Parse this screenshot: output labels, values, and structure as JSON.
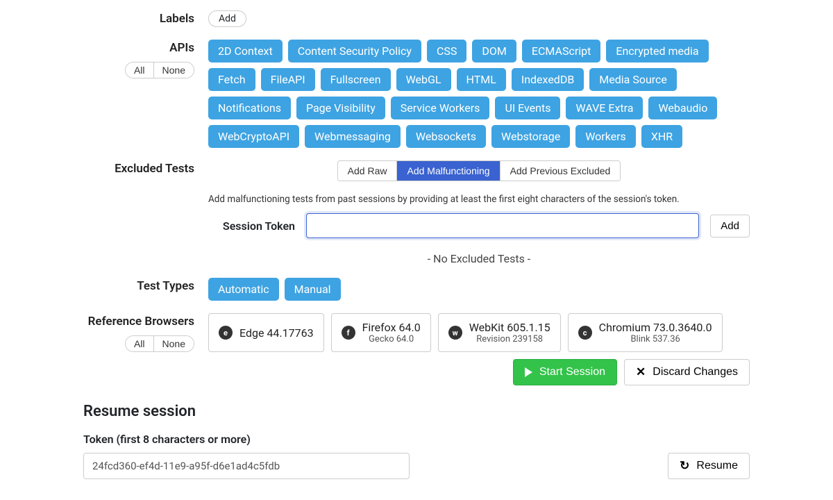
{
  "labels": {
    "title": "Labels",
    "add": "Add"
  },
  "apis": {
    "title": "APIs",
    "all": "All",
    "none": "None",
    "items": [
      "2D Context",
      "Content Security Policy",
      "CSS",
      "DOM",
      "ECMAScript",
      "Encrypted media",
      "Fetch",
      "FileAPI",
      "Fullscreen",
      "WebGL",
      "HTML",
      "IndexedDB",
      "Media Source",
      "Notifications",
      "Page Visibility",
      "Service Workers",
      "UI Events",
      "WAVE Extra",
      "Webaudio",
      "WebCryptoAPI",
      "Webmessaging",
      "Websockets",
      "Webstorage",
      "Workers",
      "XHR"
    ]
  },
  "excluded": {
    "title": "Excluded Tests",
    "seg": {
      "raw": "Add Raw",
      "malfunctioning": "Add Malfunctioning",
      "previous": "Add Previous Excluded"
    },
    "help": "Add malfunctioning tests from past sessions by providing at least the first eight characters of the session's token.",
    "tokenLabel": "Session Token",
    "addBtn": "Add",
    "empty": "- No Excluded Tests -"
  },
  "testTypes": {
    "title": "Test Types",
    "items": [
      "Automatic",
      "Manual"
    ]
  },
  "refBrowsers": {
    "title": "Reference Browsers",
    "all": "All",
    "none": "None",
    "items": [
      {
        "icon": "e",
        "name": "Edge 44.17763",
        "sub": ""
      },
      {
        "icon": "f",
        "name": "Firefox 64.0",
        "sub": "Gecko 64.0"
      },
      {
        "icon": "w",
        "name": "WebKit 605.1.15",
        "sub": "Revision 239158"
      },
      {
        "icon": "c",
        "name": "Chromium 73.0.3640.0",
        "sub": "Blink 537.36"
      }
    ]
  },
  "actions": {
    "start": "Start Session",
    "discard": "Discard Changes"
  },
  "resume": {
    "heading": "Resume session",
    "label": "Token (first 8 characters or more)",
    "value": "24fcd360-ef4d-11e9-a95f-d6e1ad4c5fdb",
    "button": "Resume"
  }
}
